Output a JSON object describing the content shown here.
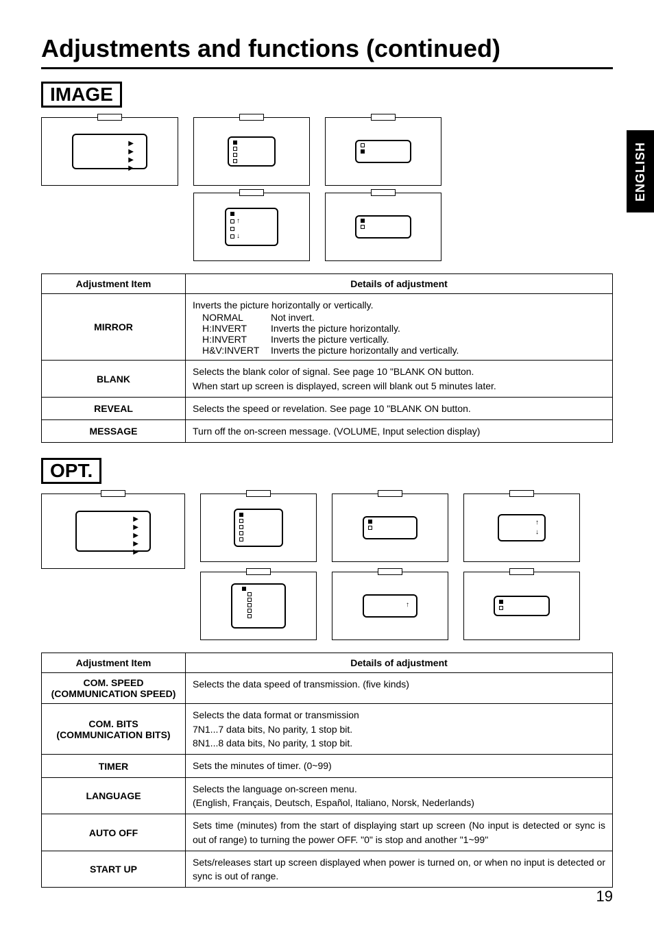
{
  "page_title": "Adjustments and functions (continued)",
  "side_tab": "ENGLISH",
  "page_number": "19",
  "sections": {
    "image": {
      "label": "IMAGE",
      "table_headers": {
        "item": "Adjustment Item",
        "details": "Details of adjustment"
      },
      "rows": [
        {
          "item": "MIRROR",
          "intro": "Inverts the picture horizontally or vertically.",
          "opts": [
            {
              "k": "NORMAL",
              "v": "Not invert."
            },
            {
              "k": "H:INVERT",
              "v": "Inverts the picture horizontally."
            },
            {
              "k": "H:INVERT",
              "v": "Inverts the picture vertically."
            },
            {
              "k": "H&V:INVERT",
              "v": "Inverts the picture horizontally and vertically."
            }
          ]
        },
        {
          "item": "BLANK",
          "details": "Selects the blank color of signal. See page 10 \"BLANK ON button.\nWhen start up screen is displayed, screen will blank out 5 minutes later."
        },
        {
          "item": "REVEAL",
          "details": "Selects the speed or revelation. See page 10 \"BLANK ON button."
        },
        {
          "item": "MESSAGE",
          "details": "Turn off the on-screen message. (VOLUME, Input selection display)"
        }
      ]
    },
    "opt": {
      "label": "OPT.",
      "table_headers": {
        "item": "Adjustment Item",
        "details": "Details of adjustment"
      },
      "rows": [
        {
          "item": "COM. SPEED",
          "sub": "(COMMUNICATION SPEED)",
          "details": "Selects the data speed of transmission. (five kinds)"
        },
        {
          "item": "COM. BITS",
          "sub": "(COMMUNICATION BITS)",
          "details": "Selects the data format or transmission\n7N1...7 data bits, No parity, 1 stop bit.\n8N1...8 data bits, No parity, 1 stop bit."
        },
        {
          "item": "TIMER",
          "details": "Sets the minutes of timer. (0~99)"
        },
        {
          "item": "LANGUAGE",
          "details": "Selects the language on-screen menu.\n(English, Français, Deutsch, Español, Italiano, Norsk, Nederlands)"
        },
        {
          "item": "AUTO OFF",
          "details": "Sets time (minutes) from the start of displaying start up screen (No input is detected or sync is out of range) to turning the power OFF. \"0\" is stop and another \"1~99\""
        },
        {
          "item": "START UP",
          "details": "Sets/releases start up screen displayed when power is turned on, or when no input is detected or sync is out of range."
        }
      ]
    }
  }
}
